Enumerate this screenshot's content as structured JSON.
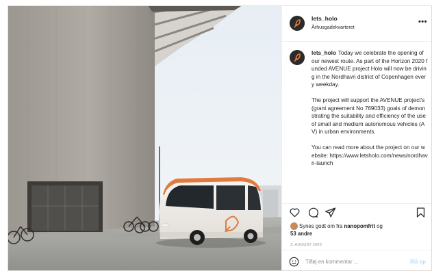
{
  "post": {
    "username": "lets_holo",
    "location": "Århusgadekvarteret",
    "more_icon": "ellipsis-icon",
    "more_label": "•••",
    "caption_paragraphs": [
      "Today we celebrate the opening of our newest route. As part of the Horizon 2020 funded AVENUE project Holo will now be driving in the Nordhavn district of Copenhagen every weekday.",
      "The project will support the AVENUE project's (grant agreement No 769033) goals of demonstrating the suitability and efficiency of the use of small and medium autonomous vehicles (AV) in urban environments.",
      "You can read more about the project on our website: https://www.letsholo.com/news/nordhavn-launch"
    ],
    "actions": {
      "like_icon": "heart-icon",
      "comment_icon": "comment-bubble-icon",
      "share_icon": "paper-plane-icon",
      "save_icon": "bookmark-icon"
    },
    "likes": {
      "prefix": "Synes godt om fra",
      "liker": "nanopomfrit",
      "joiner": "og",
      "others": "53 andre"
    },
    "date": "3. AUGUST 2020",
    "comment": {
      "placeholder": "Tilføj en kommentar ...",
      "post_label": "Slå op",
      "emoji_icon": "smiley-icon"
    },
    "colors": {
      "text": "#262626",
      "muted": "#8e8e8e",
      "post_button_disabled": "#b2dffc",
      "border": "#dbdbdb"
    }
  }
}
